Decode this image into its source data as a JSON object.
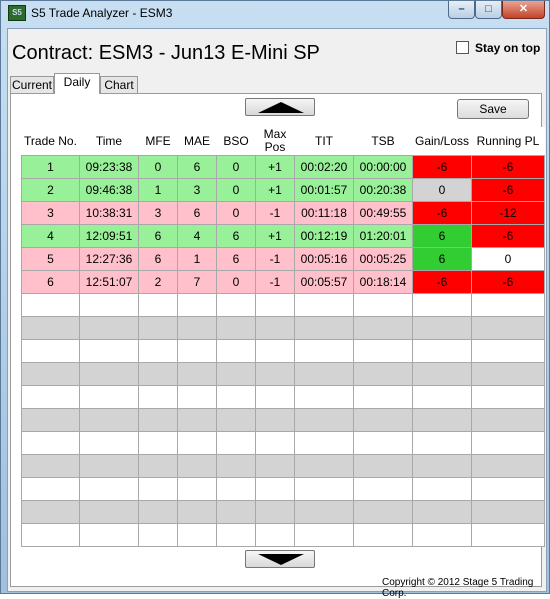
{
  "window": {
    "title": "S5 Trade Analyzer - ESM3",
    "icon_text": "S5",
    "min_icon": "minimize-icon",
    "max_icon": "maximize-icon",
    "close_icon": "close-icon"
  },
  "header": {
    "contract": "Contract: ESM3 - Jun13 E-Mini SP",
    "stay_on_top_label": "Stay on top",
    "stay_on_top_checked": false
  },
  "tabs": [
    {
      "label": "Current"
    },
    {
      "label": "Daily"
    },
    {
      "label": "Chart"
    }
  ],
  "toolbar": {
    "save_label": "Save"
  },
  "table": {
    "columns": [
      "Trade No.",
      "Time",
      "MFE",
      "MAE",
      "BSO",
      "Max Pos",
      "TIT",
      "TSB",
      "Gain/Loss",
      "Running PL"
    ],
    "rows": [
      {
        "trade_no": "1",
        "time": "09:23:38",
        "mfe": "0",
        "mae": "6",
        "bso": "0",
        "max_pos": "+1",
        "tit": "00:02:20",
        "tsb": "00:00:00",
        "gain_loss": "-6",
        "running_pl": "-6"
      },
      {
        "trade_no": "2",
        "time": "09:46:38",
        "mfe": "1",
        "mae": "3",
        "bso": "0",
        "max_pos": "+1",
        "tit": "00:01:57",
        "tsb": "00:20:38",
        "gain_loss": "0",
        "running_pl": "-6"
      },
      {
        "trade_no": "3",
        "time": "10:38:31",
        "mfe": "3",
        "mae": "6",
        "bso": "0",
        "max_pos": "-1",
        "tit": "00:11:18",
        "tsb": "00:49:55",
        "gain_loss": "-6",
        "running_pl": "-12"
      },
      {
        "trade_no": "4",
        "time": "12:09:51",
        "mfe": "6",
        "mae": "4",
        "bso": "6",
        "max_pos": "+1",
        "tit": "00:12:19",
        "tsb": "01:20:01",
        "gain_loss": "6",
        "running_pl": "-6"
      },
      {
        "trade_no": "5",
        "time": "12:27:36",
        "mfe": "6",
        "mae": "1",
        "bso": "6",
        "max_pos": "-1",
        "tit": "00:05:16",
        "tsb": "00:05:25",
        "gain_loss": "6",
        "running_pl": "0"
      },
      {
        "trade_no": "6",
        "time": "12:51:07",
        "mfe": "2",
        "mae": "7",
        "bso": "0",
        "max_pos": "-1",
        "tit": "00:05:57",
        "tsb": "00:18:14",
        "gain_loss": "-6",
        "running_pl": "-6"
      }
    ],
    "row_states": [
      "win",
      "win",
      "loss",
      "win",
      "loss",
      "loss"
    ],
    "gain_loss_colors": [
      "red",
      "gray",
      "red",
      "green",
      "green",
      "red"
    ],
    "running_pl_colors": [
      "red",
      "red",
      "red",
      "red",
      "white",
      "red"
    ],
    "empty_rows": 11
  },
  "scroll": {
    "up_icon": "arrow-up-icon",
    "down_icon": "arrow-down-icon"
  },
  "footer": {
    "copyright": "Copyright © 2012 Stage 5 Trading Corp."
  },
  "colors": {
    "win_row": "#98f098",
    "loss_row": "#ffc0cb",
    "loss_cell": "#ff0000",
    "win_cell": "#32cd32",
    "neutral_cell": "#d3d3d3"
  }
}
